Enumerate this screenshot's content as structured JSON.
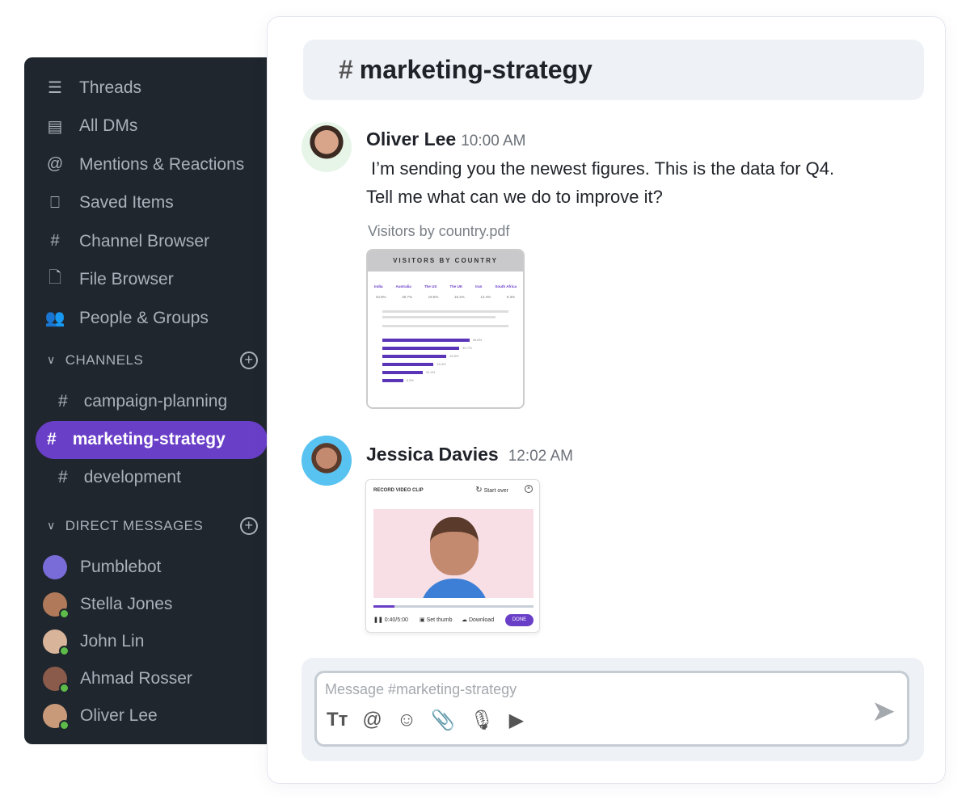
{
  "sidebar": {
    "items": [
      {
        "icon": "threads-icon",
        "glyph": "☰",
        "label": "Threads"
      },
      {
        "icon": "all-dms-icon",
        "glyph": "▤",
        "label": "All DMs"
      },
      {
        "icon": "at-icon",
        "glyph": "@",
        "label": "Mentions & Reactions"
      },
      {
        "icon": "bookmark-icon",
        "glyph": "⎕",
        "label": "Saved Items"
      },
      {
        "icon": "channel-search-icon",
        "glyph": "#",
        "label": "Channel Browser"
      },
      {
        "icon": "file-search-icon",
        "glyph": "🗋",
        "label": "File Browser"
      },
      {
        "icon": "people-icon",
        "glyph": "👥",
        "label": "People & Groups"
      }
    ],
    "channels_title": "CHANNELS",
    "channels": [
      {
        "label": "campaign-planning",
        "active": false
      },
      {
        "label": "marketing-strategy",
        "active": true
      },
      {
        "label": "development",
        "active": false
      }
    ],
    "dms_title": "DIRECT MESSAGES",
    "dms": [
      {
        "label": "Pumblebot",
        "color": "#7a6cd8",
        "online": false
      },
      {
        "label": "Stella Jones",
        "color": "#b07a5a",
        "online": true
      },
      {
        "label": "John Lin",
        "color": "#d8b49a",
        "online": true
      },
      {
        "label": "Ahmad Rosser",
        "color": "#8a5a4a",
        "online": true
      },
      {
        "label": "Oliver Lee",
        "color": "#c99a7a",
        "online": true
      }
    ]
  },
  "header": {
    "hash": "#",
    "title": "marketing-strategy"
  },
  "messages": [
    {
      "author": "Oliver Lee",
      "time": "10:00 AM",
      "text1": "I’m sending you the newest figures. This is the data for Q4.",
      "text2": "Tell me what can we do to improve it?",
      "attachment": {
        "filename": "Visitors by country.pdf",
        "title": "VISITORS BY COUNTRY",
        "countries": [
          "India",
          "Australia",
          "The US",
          "The UK",
          "Iran",
          "South Africa"
        ],
        "values": [
          "34.8%",
          "30.7%",
          "19.5%",
          "15.4%",
          "12.4%",
          "6.3%"
        ],
        "bars": [
          34.8,
          30.7,
          25.5,
          20.4,
          16.1,
          8.3
        ]
      }
    },
    {
      "author": "Jessica Davies",
      "time": "12:02 AM",
      "video": {
        "title": "RECORD VIDEO CLIP",
        "start_over": "Start over",
        "elapsed": "0:40/5:00",
        "progress": 0.13,
        "set_thumb": "Set thumb",
        "download": "Download",
        "done": "DONE"
      }
    }
  ],
  "composer": {
    "placeholder": "Message #marketing-strategy"
  },
  "colors": {
    "accent": "#6a3fc8",
    "sidebar": "#1f262d"
  }
}
